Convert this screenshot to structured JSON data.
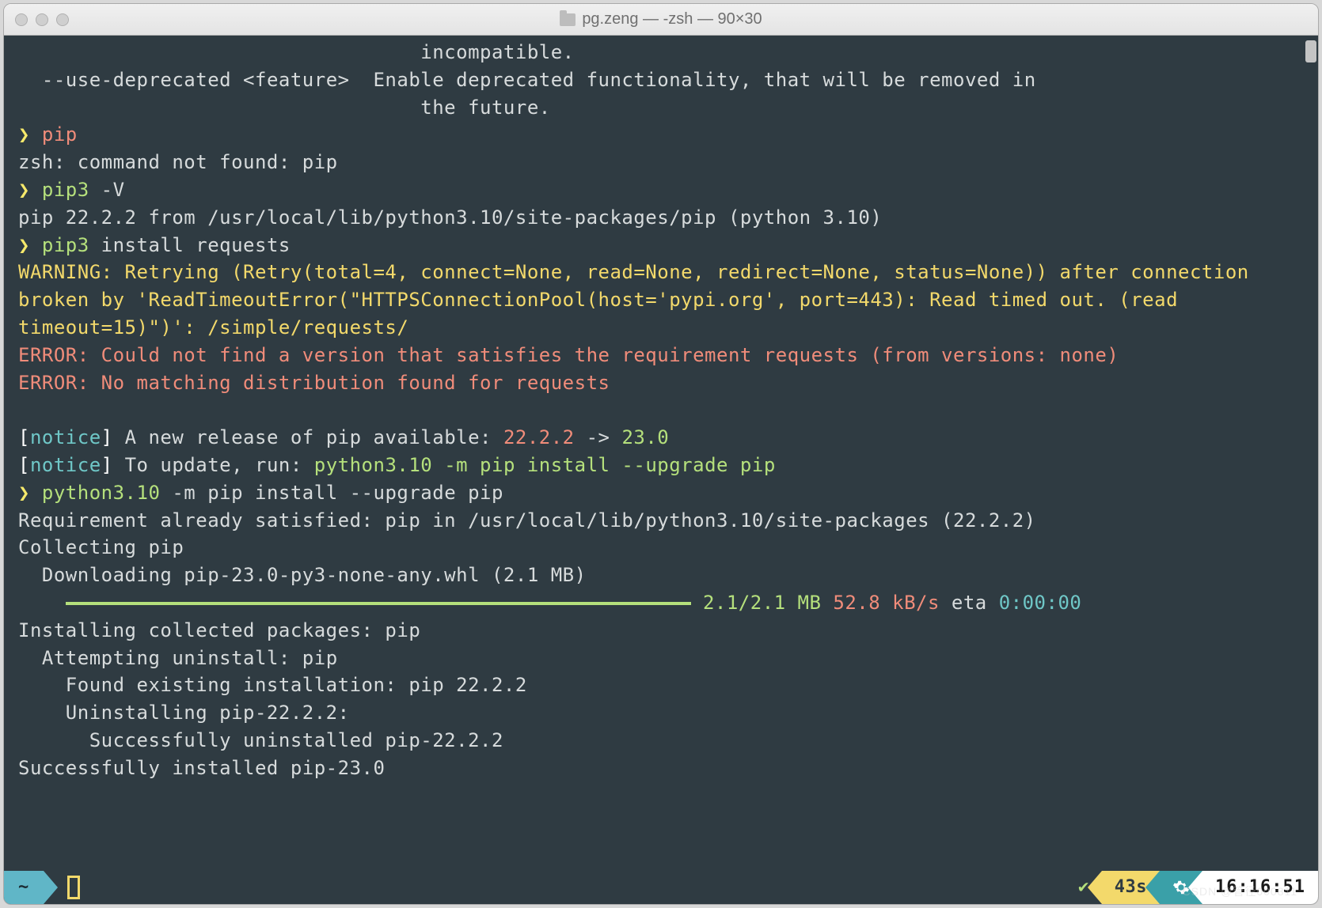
{
  "window": {
    "title": "pg.zeng — -zsh — 90×30"
  },
  "lines": {
    "help1_indent": "                                  ",
    "help1": "incompatible.",
    "help2a": "  --use-deprecated <feature>  ",
    "help2b": "Enable deprecated functionality, that will be removed in",
    "help3_indent": "                                  ",
    "help3": "the future.",
    "prompt": "❯ ",
    "cmd_pip": "pip",
    "err_pip": "zsh: command not found: pip",
    "cmd_pip3v_a": "pip3",
    "cmd_pip3v_b": " -V",
    "pipv_out": "pip 22.2.2 from /usr/local/lib/python3.10/site-packages/pip (python 3.10)",
    "cmd_inst_a": "pip3",
    "cmd_inst_b": " install requests",
    "warn": "WARNING: Retrying (Retry(total=4, connect=None, read=None, redirect=None, status=None)) after connection broken by 'ReadTimeoutError(\"HTTPSConnectionPool(host='pypi.org', port=443): Read timed out. (read timeout=15)\")': /simple/requests/",
    "err1": "ERROR: Could not find a version that satisfies the requirement requests (from versions: none)",
    "err2": "ERROR: No matching distribution found for requests",
    "notice_br_l": "[",
    "notice_word": "notice",
    "notice_br_r": "] ",
    "notice1_a": "A new release of pip available: ",
    "notice1_b": "22.2.2",
    "notice1_c": " -> ",
    "notice1_d": "23.0",
    "notice2_a": "To update, run: ",
    "notice2_b": "python3.10 -m pip install --upgrade pip",
    "cmd_upg_a": "python3.10",
    "cmd_upg_b": " -m pip install --upgrade pip",
    "req_sat": "Requirement already satisfied: pip in /usr/local/lib/python3.10/site-packages (22.2.2)",
    "collecting": "Collecting pip",
    "downloading": "  Downloading pip-23.0-py3-none-any.whl (2.1 MB)",
    "prog_size": " 2.1/2.1 MB",
    "prog_speed": " 52.8 kB/s",
    "prog_eta_l": " eta ",
    "prog_eta_v": "0:00:00",
    "inst1": "Installing collected packages: pip",
    "inst2": "  Attempting uninstall: pip",
    "inst3": "    Found existing installation: pip 22.2.2",
    "inst4": "    Uninstalling pip-22.2.2:",
    "inst5": "      Successfully uninstalled pip-22.2.2",
    "inst6": "Successfully installed pip-23.0"
  },
  "status": {
    "home": "~",
    "check": "✔",
    "duration": "43s",
    "gear": "✻",
    "clock": "16:16:51"
  },
  "watermark": "CSDN @管径000811"
}
